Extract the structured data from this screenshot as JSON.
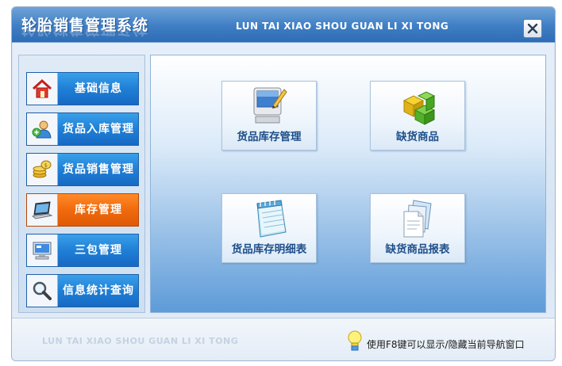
{
  "window": {
    "title": "轮胎销售管理系统",
    "title_en": "LUN TAI XIAO SHOU GUAN LI XI TONG"
  },
  "sidebar": {
    "items": [
      {
        "label": "基础信息",
        "icon": "home-icon"
      },
      {
        "label": "货品入库管理",
        "icon": "user-icon"
      },
      {
        "label": "货品销售管理",
        "icon": "coins-icon"
      },
      {
        "label": "库存管理",
        "icon": "laptop-icon",
        "active": true
      },
      {
        "label": "三包管理",
        "icon": "monitor-icon"
      },
      {
        "label": "信息统计查询",
        "icon": "magnifier-icon"
      }
    ],
    "active_color": "#f06a0c",
    "item_color": "#1f7fd6"
  },
  "main": {
    "tiles": [
      {
        "label": "货品库存管理",
        "icon": "computer-edit-icon"
      },
      {
        "label": "缺货商品",
        "icon": "cubes-icon"
      },
      {
        "label": "货品库存明细表",
        "icon": "notepad-icon"
      },
      {
        "label": "缺货商品报表",
        "icon": "documents-icon"
      }
    ]
  },
  "footer": {
    "text_en": "LUN TAI XIAO SHOU GUAN LI XI TONG",
    "hint": "使用F8键可以显示/隐藏当前导航窗口",
    "hint_icon": "lightbulb-icon"
  }
}
